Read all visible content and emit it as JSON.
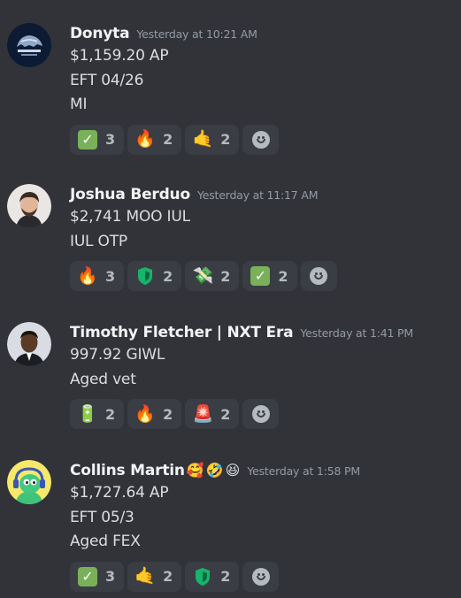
{
  "messages": [
    {
      "author": "Donyta",
      "timestamp": "Yesterday at 10:21 AM",
      "lines": [
        "$1,159.20 AP",
        "EFT 04/26",
        "MI"
      ],
      "reactions": [
        {
          "emoji": "check-mark-icon",
          "count": "3"
        },
        {
          "emoji": "fire-icon",
          "count": "2"
        },
        {
          "emoji": "call-me-hand-icon",
          "count": "2"
        }
      ]
    },
    {
      "author": "Joshua Berduo",
      "timestamp": "Yesterday at 11:17 AM",
      "lines": [
        "$2,741 MOO IUL",
        "IUL OTP"
      ],
      "reactions": [
        {
          "emoji": "fire-icon",
          "count": "3"
        },
        {
          "emoji": "green-shield-icon",
          "count": "2"
        },
        {
          "emoji": "money-with-wings-icon",
          "count": "2"
        },
        {
          "emoji": "check-mark-icon",
          "count": "2"
        }
      ]
    },
    {
      "author": "Timothy Fletcher | NXT Era",
      "timestamp": "Yesterday at 1:41 PM",
      "lines": [
        "997.92 GIWL",
        "Aged vet"
      ],
      "reactions": [
        {
          "emoji": "battery-icon",
          "count": "2"
        },
        {
          "emoji": "fire-spark-icon",
          "count": "2"
        },
        {
          "emoji": "siren-light-icon",
          "count": "2"
        }
      ]
    },
    {
      "author": "Collins Martin",
      "name_emojis": [
        "🥰",
        "🤣",
        "😆"
      ],
      "timestamp": "Yesterday at 1:58 PM",
      "lines": [
        "$1,727.64 AP",
        "EFT 05/3",
        "Aged FEX"
      ],
      "reactions": [
        {
          "emoji": "check-mark-icon",
          "count": "3"
        },
        {
          "emoji": "call-me-hand-icon",
          "count": "2"
        },
        {
          "emoji": "green-shield-icon",
          "count": "2"
        }
      ]
    }
  ],
  "colors": {
    "background": "#313338",
    "reaction_bg": "#3b3d44",
    "username": "#f2f3f5",
    "timestamp": "#949ba4",
    "text": "#dbdee1"
  }
}
